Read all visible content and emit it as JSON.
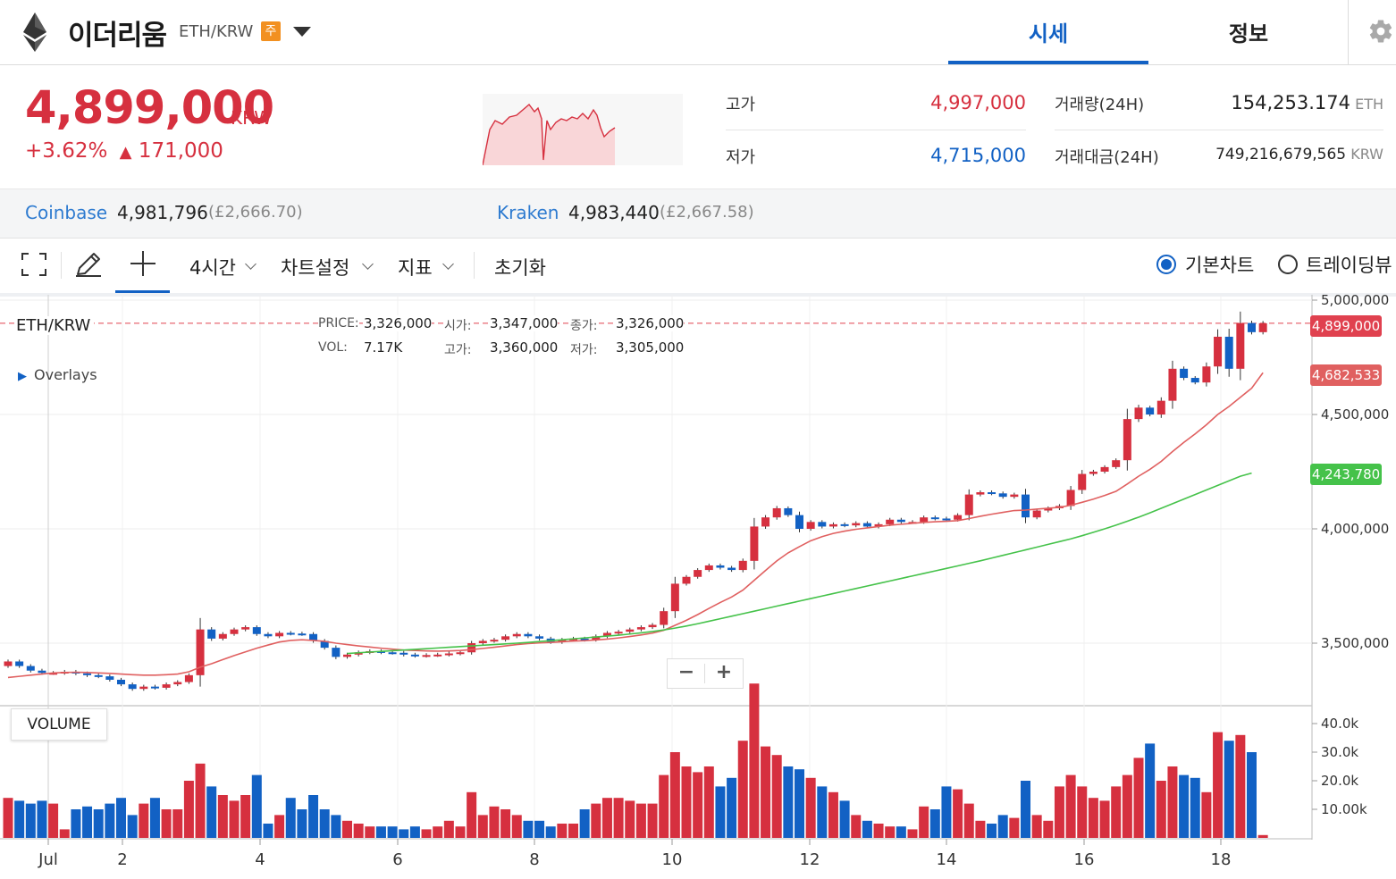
{
  "header": {
    "coin_name": "이더리움",
    "pair": "ETH/KRW",
    "badge": "주",
    "tabs": [
      {
        "label": "시세",
        "active": true
      },
      {
        "label": "정보",
        "active": false
      }
    ],
    "accent_color": "#1261c4"
  },
  "summary": {
    "price": "4,899,000",
    "price_unit": "KRW",
    "change_pct": "+3.62%",
    "change_arrow": "▲",
    "change_amount": "171,000",
    "high_label": "고가",
    "high_value": "4,997,000",
    "low_label": "저가",
    "low_value": "4,715,000",
    "volume_label": "거래량(24H)",
    "volume_value": "154,253.174",
    "volume_unit": "ETH",
    "amount_label": "거래대금(24H)",
    "amount_value": "749,216,679,565",
    "amount_unit": "KRW",
    "up_color": "#d6303f",
    "down_color": "#1261c4"
  },
  "exchanges": [
    {
      "name": "Coinbase",
      "price": "4,981,796",
      "gbp": "(£2,666.70)"
    },
    {
      "name": "Kraken",
      "price": "4,983,440",
      "gbp": "(£2,667.58)"
    }
  ],
  "toolbar": {
    "interval": "4시간",
    "chart_settings": "차트설정",
    "indicators": "지표",
    "reset": "초기화",
    "chart_types": [
      {
        "label": "기본차트",
        "selected": true
      },
      {
        "label": "트레이딩뷰",
        "selected": false
      }
    ]
  },
  "chart_legend": {
    "symbol": "ETH/KRW",
    "price_label": "PRICE:",
    "price": "3,326,000",
    "open_label": "시가:",
    "open": "3,347,000",
    "close_label": "종가:",
    "close": "3,326,000",
    "vol_label": "VOL:",
    "vol": "7.17K",
    "high_label": "고가:",
    "high": "3,360,000",
    "low_label": "저가:",
    "low": "3,305,000",
    "overlays": "Overlays",
    "zoom_out": "−",
    "zoom_in": "+"
  },
  "price_tags": {
    "last": "4,899,000",
    "ma_short": "4,682,533",
    "ma_long": "4,243,780",
    "ma_short_color": "#e06060",
    "ma_long_color": "#45c24a"
  },
  "volume_panel": {
    "title": "VOLUME"
  },
  "chart_data": {
    "type": "candlestick",
    "interval": "4h",
    "y_ticks": [
      "5,000,000",
      "4,500,000",
      "4,000,000",
      "3,500,000"
    ],
    "y_tick_values": [
      5000000,
      4500000,
      4000000,
      3500000
    ],
    "volume_ticks": [
      "40.0k",
      "30.0k",
      "20.0k",
      "10.00k"
    ],
    "volume_tick_values": [
      40000,
      30000,
      20000,
      10000
    ],
    "x_ticks": [
      "Jul",
      "2",
      "4",
      "6",
      "8",
      "10",
      "12",
      "14",
      "16",
      "18"
    ],
    "closes": [
      3420000,
      3400000,
      3380000,
      3370000,
      3370000,
      3375000,
      3368000,
      3360000,
      3355000,
      3340000,
      3320000,
      3300000,
      3310000,
      3305000,
      3320000,
      3330000,
      3360000,
      3560000,
      3520000,
      3540000,
      3560000,
      3570000,
      3540000,
      3530000,
      3545000,
      3542000,
      3540000,
      3510000,
      3480000,
      3440000,
      3450000,
      3460000,
      3465000,
      3460000,
      3458000,
      3450000,
      3445000,
      3448000,
      3450000,
      3455000,
      3460000,
      3500000,
      3510000,
      3515000,
      3530000,
      3540000,
      3530000,
      3520000,
      3505000,
      3515000,
      3520000,
      3515000,
      3530000,
      3545000,
      3550000,
      3560000,
      3570000,
      3580000,
      3640000,
      3760000,
      3790000,
      3820000,
      3840000,
      3830000,
      3820000,
      3860000,
      4010000,
      4050000,
      4090000,
      4060000,
      4000000,
      4030000,
      4010000,
      4020000,
      4015000,
      4025000,
      4010000,
      4020000,
      4040000,
      4030000,
      4030000,
      4050000,
      4045000,
      4040000,
      4060000,
      4150000,
      4160000,
      4155000,
      4140000,
      4150000,
      4050000,
      4080000,
      4090000,
      4100000,
      4170000,
      4240000,
      4250000,
      4270000,
      4300000,
      4480000,
      4530000,
      4500000,
      4560000,
      4700000,
      4660000,
      4640000,
      4710000,
      4840000,
      4700000,
      4900000,
      4860000,
      4899000
    ],
    "ma_short": [
      3350000,
      3355000,
      3360000,
      3365000,
      3370000,
      3372000,
      3373000,
      3372000,
      3370000,
      3368000,
      3365000,
      3362000,
      3360000,
      3360000,
      3362000,
      3365000,
      3375000,
      3395000,
      3410000,
      3428000,
      3446000,
      3462000,
      3478000,
      3492000,
      3505000,
      3512000,
      3515000,
      3512000,
      3508000,
      3500000,
      3494000,
      3488000,
      3483000,
      3478000,
      3474000,
      3470000,
      3468000,
      3466000,
      3465000,
      3466000,
      3468000,
      3472000,
      3477000,
      3482000,
      3488000,
      3494000,
      3498000,
      3501000,
      3503000,
      3506000,
      3509000,
      3511000,
      3514000,
      3518000,
      3523000,
      3529000,
      3536000,
      3544000,
      3556000,
      3578000,
      3600000,
      3625000,
      3652000,
      3678000,
      3702000,
      3732000,
      3775000,
      3818000,
      3860000,
      3895000,
      3922000,
      3948000,
      3966000,
      3980000,
      3990000,
      3998000,
      4004000,
      4010000,
      4016000,
      4020000,
      4024000,
      4028000,
      4031000,
      4033000,
      4036000,
      4045000,
      4055000,
      4064000,
      4072000,
      4080000,
      4082000,
      4086000,
      4090000,
      4094000,
      4103000,
      4116000,
      4130000,
      4146000,
      4164000,
      4196000,
      4230000,
      4260000,
      4295000,
      4338000,
      4378000,
      4415000,
      4455000,
      4500000,
      4535000,
      4575000,
      4615000,
      4682533
    ],
    "ma_long_start_index": 30,
    "ma_long": [
      3455000,
      3458000,
      3461000,
      3464000,
      3467000,
      3470000,
      3473000,
      3476000,
      3479000,
      3482000,
      3485000,
      3488000,
      3491000,
      3494000,
      3497000,
      3500000,
      3503000,
      3507000,
      3511000,
      3515000,
      3519000,
      3523000,
      3527000,
      3531000,
      3535000,
      3540000,
      3545000,
      3551000,
      3558000,
      3566000,
      3575000,
      3585000,
      3596000,
      3607000,
      3618000,
      3629000,
      3640000,
      3651000,
      3662000,
      3673000,
      3684000,
      3695000,
      3706000,
      3717000,
      3728000,
      3739000,
      3750000,
      3761000,
      3772000,
      3783000,
      3794000,
      3805000,
      3816000,
      3827000,
      3838000,
      3849000,
      3860000,
      3872000,
      3884000,
      3896000,
      3908000,
      3920000,
      3932000,
      3944000,
      3956000,
      3970000,
      3985000,
      4000000,
      4016000,
      4033000,
      4051000,
      4070000,
      4090000,
      4110000,
      4130000,
      4150000,
      4170000,
      4190000,
      4210000,
      4230000,
      4243780
    ],
    "volumes": [
      14000,
      13000,
      12000,
      13000,
      12000,
      3000,
      10000,
      11000,
      10000,
      12000,
      14000,
      8000,
      12000,
      14000,
      10000,
      10000,
      20000,
      26000,
      18000,
      15000,
      13000,
      15000,
      22000,
      5000,
      8000,
      14000,
      10000,
      15000,
      10000,
      8000,
      6000,
      5000,
      4000,
      4000,
      4000,
      3000,
      4000,
      3000,
      4000,
      6000,
      4000,
      16000,
      8000,
      11000,
      10000,
      8000,
      6000,
      6000,
      4000,
      5000,
      5000,
      10000,
      12000,
      14000,
      14000,
      13000,
      12000,
      12000,
      22000,
      30000,
      25000,
      23000,
      25000,
      18000,
      21000,
      34000,
      54000,
      32000,
      29000,
      25000,
      24000,
      21000,
      18000,
      16000,
      13000,
      8000,
      6000,
      5000,
      4000,
      4000,
      3000,
      11000,
      10000,
      18000,
      17000,
      12000,
      6000,
      5000,
      8000,
      7000,
      20000,
      8000,
      6000,
      18000,
      22000,
      18000,
      14000,
      13000,
      18000,
      22000,
      28000,
      33000,
      20000,
      25000,
      22000,
      21000,
      16000,
      37000,
      34000,
      36000,
      30000,
      1000
    ]
  }
}
